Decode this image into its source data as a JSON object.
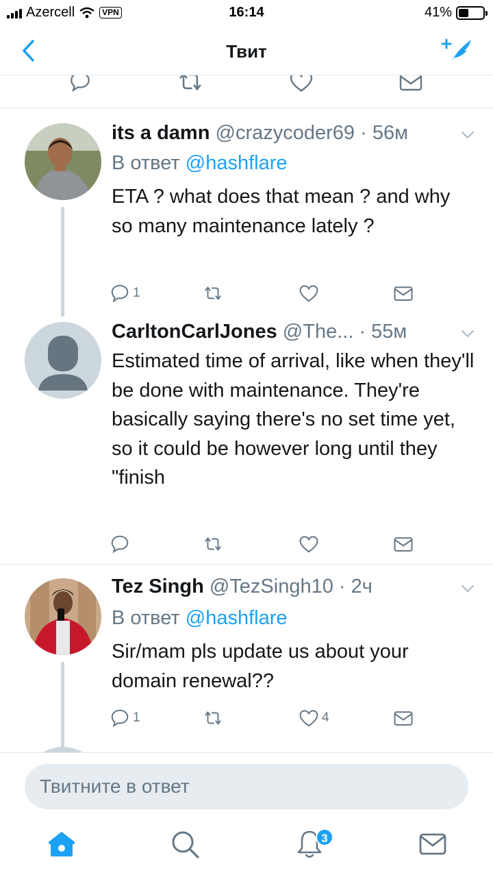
{
  "status_bar": {
    "carrier": "Azercell",
    "vpn": "VPN",
    "time": "16:14",
    "battery": "41%",
    "battery_level": 0.41
  },
  "nav": {
    "title": "Твит",
    "back_icon": "chevron-left-icon",
    "compose_icon": "compose-tweet-icon"
  },
  "tweets": [
    {
      "name": "its a damn",
      "handle": "@crazycoder69",
      "time": "56м",
      "reply_prefix": "В ответ",
      "reply_handle": "@hashflare",
      "text": "ETA ? what does that mean ? and why so many maintenance lately ?",
      "replies": "1",
      "retweets": "",
      "likes": ""
    },
    {
      "name": "CarltonCarlJones",
      "handle": "@The...",
      "time": "55м",
      "text": "Estimated time of arrival, like when they'll be done with maintenance. They're basically saying there's no set time yet, so it could be however long until they \"finish",
      "replies": "",
      "retweets": "",
      "likes": ""
    },
    {
      "name": "Tez Singh",
      "handle": "@TezSingh10",
      "time": "2ч",
      "reply_prefix": "В ответ",
      "reply_handle": "@hashflare",
      "text": "Sir/mam  pls update us about your domain renewal??",
      "replies": "1",
      "retweets": "",
      "likes": "4"
    }
  ],
  "reply_bar": {
    "placeholder": "Твитните в ответ"
  },
  "tab_bar": {
    "notifications_badge": "3"
  },
  "colors": {
    "accent": "#1da1f2",
    "secondary_text": "#657786",
    "divider": "#e1e8ed"
  }
}
